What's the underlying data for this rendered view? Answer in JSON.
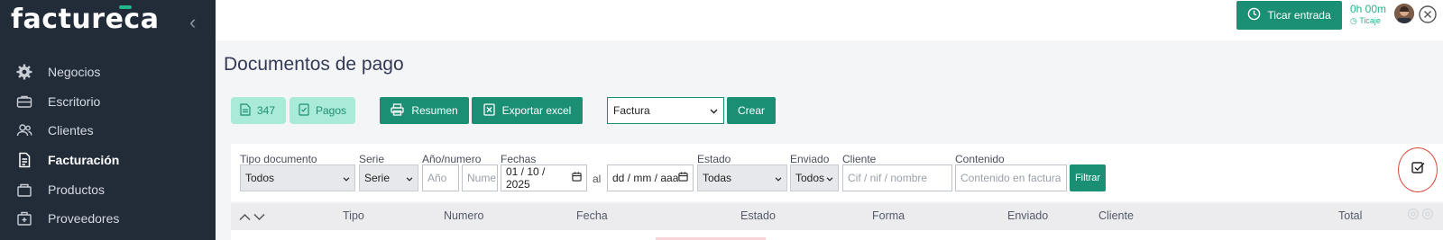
{
  "sidebar": {
    "logo": "factureca",
    "items": [
      {
        "label": "Negocios",
        "icon": "gear-icon"
      },
      {
        "label": "Escritorio",
        "icon": "briefcase-icon"
      },
      {
        "label": "Clientes",
        "icon": "users-icon"
      },
      {
        "label": "Facturación",
        "icon": "invoice-icon",
        "active": true
      },
      {
        "label": "Productos",
        "icon": "box-icon"
      },
      {
        "label": "Proveedores",
        "icon": "supplier-icon"
      }
    ]
  },
  "topbar": {
    "ticar_label": "Ticar entrada",
    "timer_value": "0h 00m",
    "timer_caption": "Ticaje"
  },
  "page": {
    "title": "Documentos de pago",
    "chips": {
      "c347": "347",
      "pagos": "Pagos"
    },
    "buttons": {
      "resumen": "Resumen",
      "exportar": "Exportar excel",
      "crear": "Crear"
    },
    "doc_type_selected": "Factura"
  },
  "filters": {
    "labels": {
      "tipo": "Tipo documento",
      "serie": "Serie",
      "anio": "Año/numero",
      "fechas": "Fechas",
      "estado": "Estado",
      "enviado": "Enviado",
      "cliente": "Cliente",
      "contenido": "Contenido"
    },
    "tipo_value": "Todos",
    "serie_value": "Serie",
    "anio_placeholder": "Año",
    "numero_placeholder": "Nume",
    "fecha_desde": "01 / 10 / 2025",
    "al": "al",
    "fecha_hasta": "dd / mm / aaaa",
    "estado_value": "Todas",
    "enviado_value": "Todos",
    "cliente_placeholder": "Cif / nif / nombre",
    "contenido_placeholder": "Contenido en factura",
    "filtrar": "Filtrar"
  },
  "table": {
    "columns": [
      "Tipo",
      "Numero",
      "Fecha",
      "Estado",
      "Forma",
      "Enviado",
      "Cliente",
      "Total"
    ]
  },
  "colors": {
    "sidebar_bg": "#222b38",
    "accent": "#1b8f74",
    "chip_bg": "#a9ead9",
    "highlight_circle": "#e0483b"
  }
}
